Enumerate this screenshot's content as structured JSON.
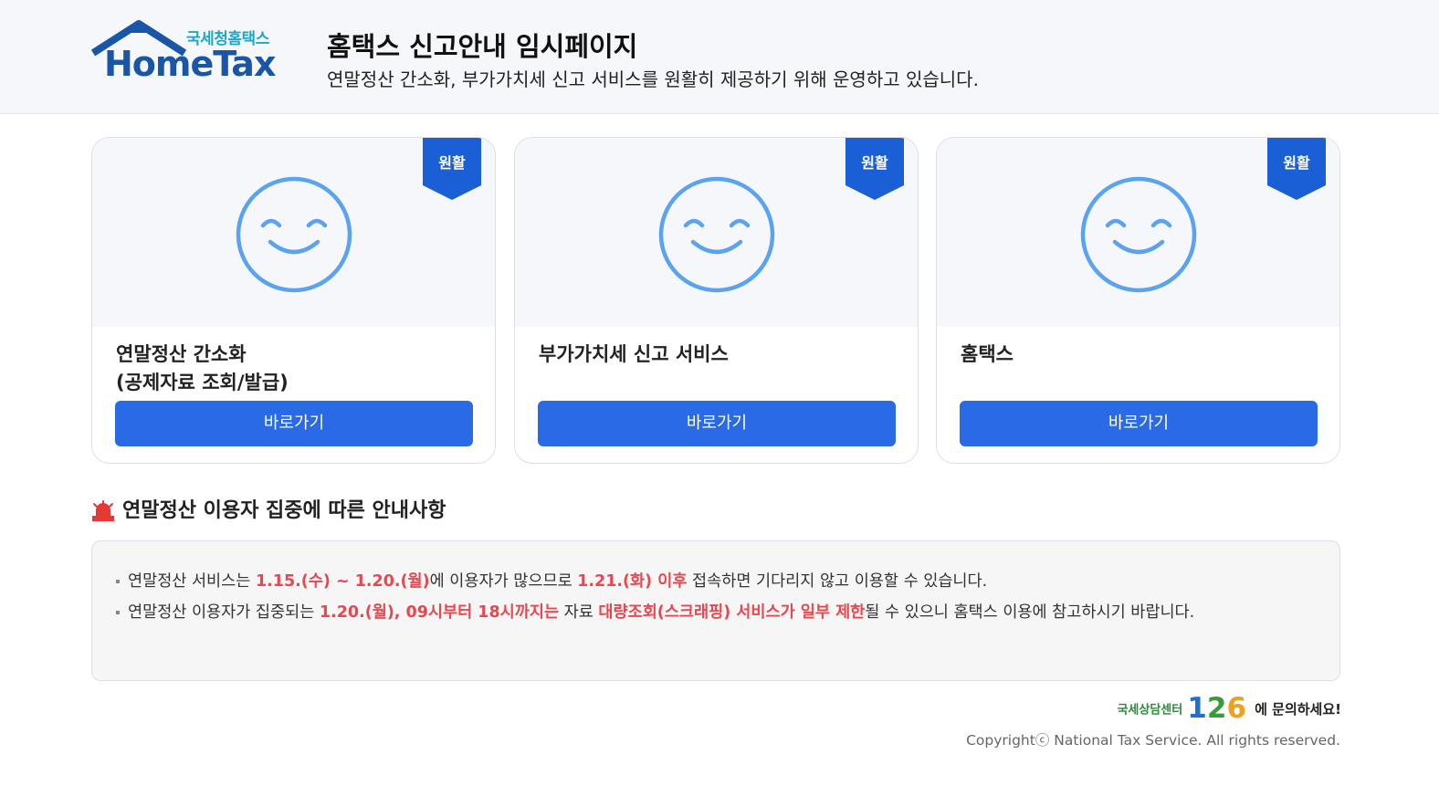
{
  "header": {
    "logo_korean": "국세청홈택스",
    "logo_english": "HomeTax",
    "title": "홈택스 신고안내 임시페이지",
    "subtitle": "연말정산 간소화, 부가가치세 신고 서비스를 원활히 제공하기 위해 운영하고 있습니다."
  },
  "cards": [
    {
      "badge": "원활",
      "icon": "smile-icon",
      "name_line1": "연말정산 간소화",
      "name_line2": "(공제자료 조회/발급)",
      "button": "바로가기"
    },
    {
      "badge": "원활",
      "icon": "smile-icon",
      "name_line1": "부가가치세 신고 서비스",
      "name_line2": "",
      "button": "바로가기"
    },
    {
      "badge": "원활",
      "icon": "smile-icon",
      "name_line1": "홈택스",
      "name_line2": "",
      "button": "바로가기"
    }
  ],
  "notice": {
    "icon": "siren-icon",
    "title": "연말정산 이용자 집중에 따른 안내사항",
    "item1": {
      "p1": "연말정산 서비스는 ",
      "h1": "1.15.(수) ~ 1.20.(월)",
      "p2": "에 이용자가 많으므로 ",
      "h2": "1.21.(화) 이후",
      "p3": " 접속하면 기다리지 않고 이용할 수 있습니다."
    },
    "item2": {
      "p1": "연말정산 이용자가 집중되는 ",
      "h1": "1.20.(월), 09시부터 18시까지는",
      "p2": " 자료 ",
      "h2": "대량조회(스크래핑) 서비스가 일부 제한",
      "p3": "될 수 있으니 홈택스 이용에 참고하시기 바랍니다."
    }
  },
  "footer": {
    "center_label": "국세상담센터",
    "center_number_1": "1",
    "center_number_2": "2",
    "center_number_3": "6",
    "center_suffix": "에 문의하세요!",
    "copyright": "Copyrightⓒ National Tax Service. All rights reserved."
  },
  "colors": {
    "primary_button": "#2b6ae6",
    "badge": "#1a5fd6",
    "smile": "#5aa3f0",
    "highlight": "#e8474f"
  }
}
